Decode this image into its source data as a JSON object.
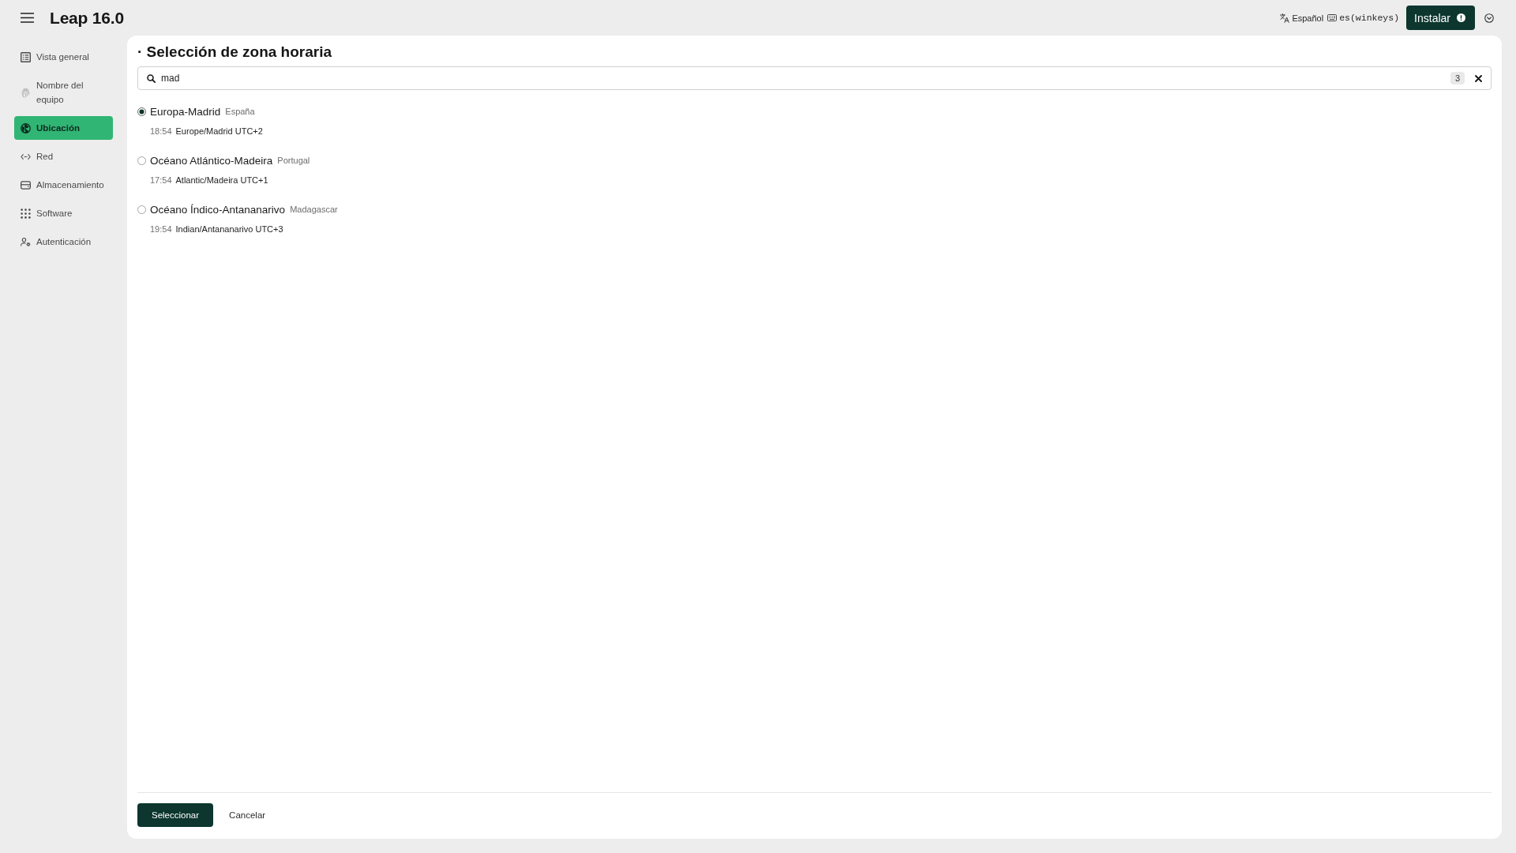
{
  "header": {
    "title": "Leap 16.0",
    "language": "Español",
    "keyboard_layout": "es(winkeys)",
    "install_button": "Instalar"
  },
  "sidebar": {
    "items": [
      {
        "label": "Vista general",
        "selected": false
      },
      {
        "label": "Nombre del equipo",
        "selected": false
      },
      {
        "label": "Ubicación",
        "selected": true
      },
      {
        "label": "Red",
        "selected": false
      },
      {
        "label": "Almacenamiento",
        "selected": false
      },
      {
        "label": "Software",
        "selected": false
      },
      {
        "label": "Autenticación",
        "selected": false
      }
    ]
  },
  "page": {
    "title": "· Selección de zona horaria",
    "search": {
      "value": "mad",
      "count": "3"
    },
    "results": [
      {
        "name": "Europa-Madrid",
        "country": "España",
        "time": "18:54",
        "zone": "Europe/Madrid UTC+2",
        "selected": true
      },
      {
        "name": "Océano Atlántico-Madeira",
        "country": "Portugal",
        "time": "17:54",
        "zone": "Atlantic/Madeira UTC+1",
        "selected": false
      },
      {
        "name": "Océano Índico-Antananarivo",
        "country": "Madagascar",
        "time": "19:54",
        "zone": "Indian/Antananarivo UTC+3",
        "selected": false
      }
    ],
    "buttons": [
      {
        "label": "Seleccionar",
        "kind": "primary"
      },
      {
        "label": "Cancelar",
        "kind": "link"
      }
    ]
  }
}
